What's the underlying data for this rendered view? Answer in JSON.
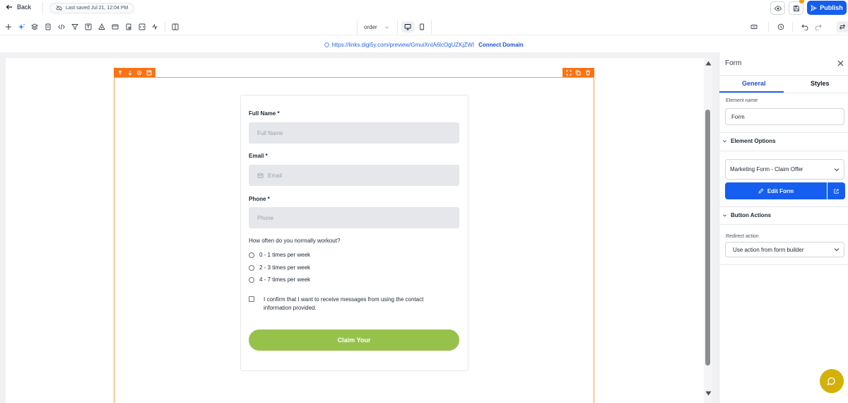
{
  "topbar": {
    "back_label": "Back",
    "saved_status": "Last saved Jul 21, 12:04 PM",
    "publish_label": "Publish",
    "accent_color": "#155eef",
    "unsaved_dot_color": "#f59e0b"
  },
  "toolbar": {
    "icons": [
      "add-icon",
      "ai-sparkle-icon",
      "layers-icon",
      "pages-icon",
      "code-icon",
      "funnel-icon",
      "text-icon",
      "triggers-icon",
      "section-icon",
      "forms-icon",
      "custom-code-icon",
      "tracking-icon",
      "columns-icon",
      "history-icon",
      "undo-icon",
      "redo-icon",
      "swap-icon"
    ],
    "page_select_value": "order",
    "device_selected": "desktop"
  },
  "urlbar": {
    "preview_url": "https://links.digi5y.com/preview/GmuiXnIA6lcOgUZKjZWI",
    "connect_domain_label": "Connect Domain"
  },
  "form": {
    "fields": [
      {
        "label": "Full Name *",
        "placeholder": "Full Name"
      },
      {
        "label": "Email *",
        "placeholder": "Email"
      },
      {
        "label": "Phone *",
        "placeholder": "Phone"
      }
    ],
    "question": "How often do you normally workout?",
    "options": [
      "0 - 1 times per week",
      "2 - 3 times per week",
      "4 - 7 times per week"
    ],
    "consent_text": "I confirm that I want to receive messages from using the contact information provided.",
    "submit_label": "Claim Your",
    "submit_color": "#96c24c",
    "section_outline_color": "#f97316"
  },
  "panel": {
    "title": "Form",
    "tabs": {
      "general": "General",
      "styles": "Styles"
    },
    "active_tab": "General",
    "element_name_label": "Element name",
    "element_name_value": "Form",
    "element_options_heading": "Element Options",
    "selected_form": "Marketing Form - Claim Offer",
    "edit_form_label": "Edit Form",
    "button_actions_heading": "Button Actions",
    "redirect_label": "Redirect action",
    "redirect_value": "Use action from form builder"
  }
}
